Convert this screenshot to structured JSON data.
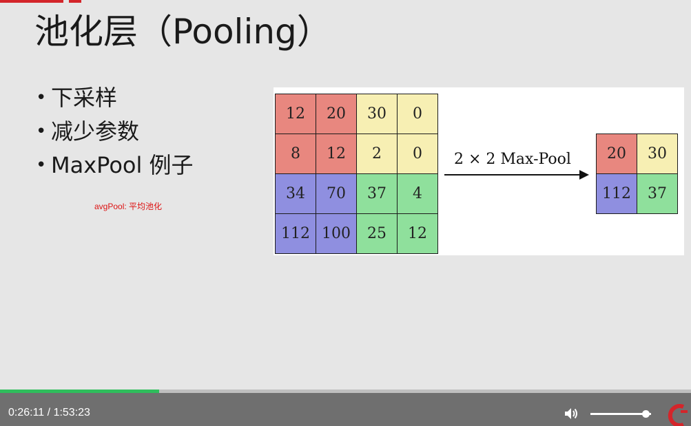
{
  "slide": {
    "title": "池化层（Pooling）",
    "bullets": [
      {
        "dot": "•",
        "text": "下采样"
      },
      {
        "dot": "•",
        "text": "减少参数"
      },
      {
        "dot": "•",
        "text": "MaxPool 例子"
      }
    ],
    "note": "avgPool: 平均池化",
    "figure": {
      "input_grid": [
        [
          "12",
          "20",
          "30",
          "0"
        ],
        [
          "8",
          "12",
          "2",
          "0"
        ],
        [
          "34",
          "70",
          "37",
          "4"
        ],
        [
          "112",
          "100",
          "25",
          "12"
        ]
      ],
      "arrow_label": "2 × 2 Max-Pool",
      "output_grid": [
        [
          "20",
          "30"
        ],
        [
          "112",
          "37"
        ]
      ],
      "colors": {
        "red": "#e8877f",
        "yellow": "#f7efb3",
        "blue": "#8f8fe0",
        "green": "#8fe09c"
      }
    }
  },
  "player": {
    "current_time": "0:26:11",
    "separator": "/",
    "duration": "1:53:23",
    "progress_fraction": 0.23,
    "volume_fraction": 0.92,
    "icons": [
      "volume-icon",
      "brand-logo-icon"
    ],
    "progress_color": "#2fbd5c"
  }
}
